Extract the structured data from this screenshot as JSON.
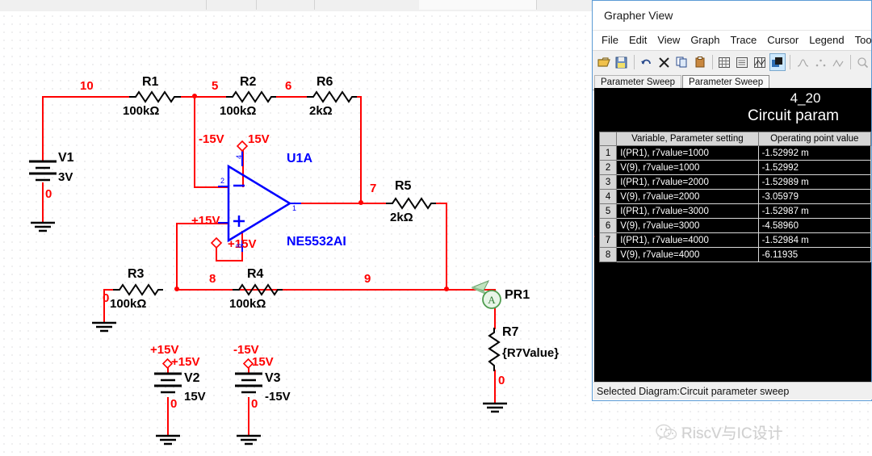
{
  "schematic": {
    "nodes": {
      "n10": "10",
      "n5": "5",
      "n6": "6",
      "n7": "7",
      "n8": "8",
      "n9": "9",
      "gnd_v1": "0",
      "gnd_r3": "0",
      "gnd_v2": "0",
      "gnd_v3": "0",
      "gnd_r7": "0"
    },
    "components": [
      {
        "ref": "R1",
        "value": "100kΩ"
      },
      {
        "ref": "R2",
        "value": "100kΩ"
      },
      {
        "ref": "R6",
        "value": "2kΩ"
      },
      {
        "ref": "R5",
        "value": "2kΩ"
      },
      {
        "ref": "R3",
        "value": "100kΩ"
      },
      {
        "ref": "R4",
        "value": "100kΩ"
      },
      {
        "ref": "R7",
        "value": "{R7Value}"
      },
      {
        "ref": "V1",
        "value": "3V"
      },
      {
        "ref": "V2",
        "value": "15V"
      },
      {
        "ref": "V3",
        "value": "-15V"
      }
    ],
    "opamp": {
      "ref": "U1A",
      "part": "NE5532AI",
      "pin_minus": "2",
      "pin_plus": "3",
      "pin_out": "1",
      "pin_vpos": "4",
      "pin_vneg": "8"
    },
    "rails": {
      "neg_near_inv": "-15V",
      "tag_top": "15V",
      "pos_near_noninv": "+15V",
      "tag_bottom": "+15V",
      "v2_tag": "+15V",
      "v3_tag": "15V",
      "v2_net": "+15V",
      "v3_net": "-15V"
    },
    "probe": {
      "ref": "PR1",
      "glyph": "A"
    }
  },
  "grapher": {
    "title": "Grapher View",
    "menus": [
      "File",
      "Edit",
      "View",
      "Graph",
      "Trace",
      "Cursor",
      "Legend",
      "Tool"
    ],
    "toolbar_icons": [
      "open-icon",
      "save-icon",
      "undo-icon",
      "delete-icon",
      "copy-icon",
      "paste-icon",
      "grid-icon",
      "legend-icon",
      "cursors-icon",
      "chart-properties-icon",
      "trace-peak-icon",
      "trace-points-icon",
      "trace-multi-icon"
    ],
    "tabs": [
      {
        "label": "Parameter Sweep",
        "active": false
      },
      {
        "label": "Parameter Sweep",
        "active": true
      }
    ],
    "plot": {
      "title_line1": "4_20",
      "title_line2": "Circuit param",
      "columns": [
        "",
        "Variable, Parameter setting",
        "Operating point value"
      ],
      "rows": [
        {
          "n": "1",
          "variable": "I(PR1),  r7value=1000",
          "value": "-1.52992 m"
        },
        {
          "n": "2",
          "variable": "V(9),  r7value=1000",
          "value": "-1.52992"
        },
        {
          "n": "3",
          "variable": "I(PR1),  r7value=2000",
          "value": "-1.52989 m"
        },
        {
          "n": "4",
          "variable": "V(9),  r7value=2000",
          "value": "-3.05979"
        },
        {
          "n": "5",
          "variable": "I(PR1),  r7value=3000",
          "value": "-1.52987 m"
        },
        {
          "n": "6",
          "variable": "V(9),  r7value=3000",
          "value": "-4.58960"
        },
        {
          "n": "7",
          "variable": "I(PR1),  r7value=4000",
          "value": "-1.52984 m"
        },
        {
          "n": "8",
          "variable": "V(9),  r7value=4000",
          "value": "-6.11935"
        }
      ],
      "marked_row": 6
    },
    "status": "Selected Diagram:Circuit parameter sweep"
  },
  "watermark": {
    "text": "RiscV与IC设计",
    "icon": "wechat-icon"
  },
  "colors": {
    "wire": "#ff0000",
    "device": "#000000",
    "opamp": "#0000ff",
    "accent": "#5b9bd5"
  }
}
